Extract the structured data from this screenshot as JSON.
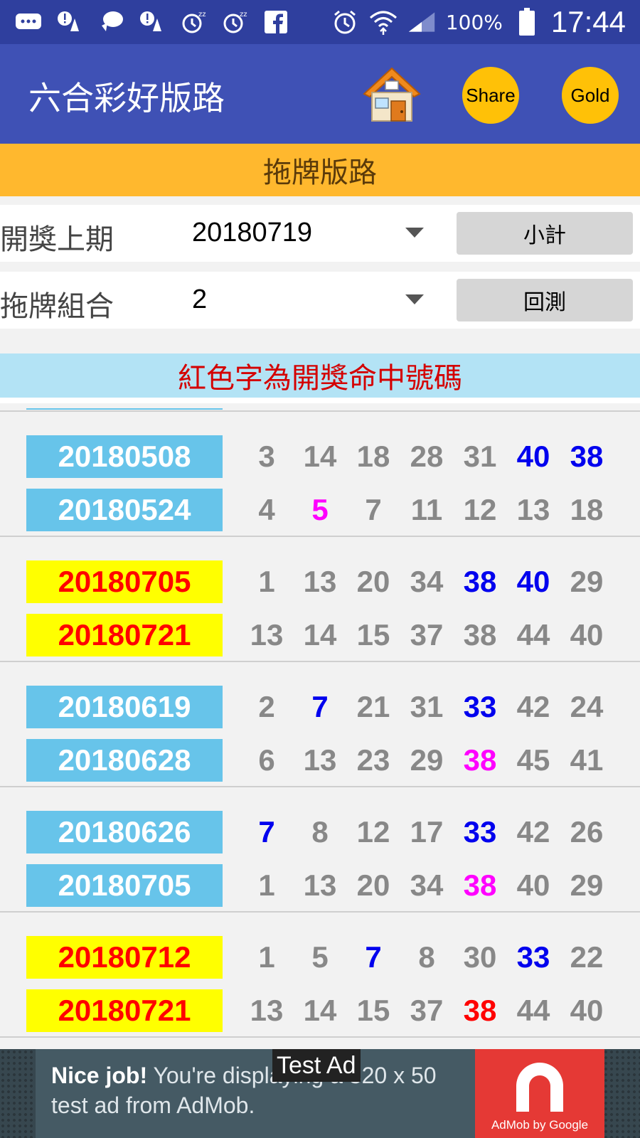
{
  "status_bar": {
    "battery": "100%",
    "time": "17:44"
  },
  "app_bar": {
    "title": "六合彩好版路",
    "share_label": "Share",
    "gold_label": "Gold"
  },
  "section": {
    "title": "拖牌版路"
  },
  "controls": {
    "period_label": "開獎上期",
    "period_value": "20180719",
    "subtotal_label": "小計",
    "combo_label": "拖牌組合",
    "combo_value": "2",
    "backtest_label": "回測"
  },
  "notice": {
    "text": "紅色字為開獎命中號碼"
  },
  "colors": {
    "gray": "#888888",
    "blue": "#0000ee",
    "magenta": "#ff00ff",
    "red": "#ff0000",
    "date_blue_bg": "#67c4ea",
    "date_yellow_bg": "#ffff00"
  },
  "groups": [
    {
      "rows": [
        {
          "date": "20180508",
          "style": "blue",
          "numbers": [
            {
              "n": "3",
              "c": "gray"
            },
            {
              "n": "14",
              "c": "gray"
            },
            {
              "n": "18",
              "c": "gray"
            },
            {
              "n": "28",
              "c": "gray"
            },
            {
              "n": "31",
              "c": "gray"
            },
            {
              "n": "40",
              "c": "blue"
            },
            {
              "n": "38",
              "c": "blue"
            }
          ]
        },
        {
          "date": "20180524",
          "style": "blue",
          "numbers": [
            {
              "n": "4",
              "c": "gray"
            },
            {
              "n": "5",
              "c": "magenta"
            },
            {
              "n": "7",
              "c": "gray"
            },
            {
              "n": "11",
              "c": "gray"
            },
            {
              "n": "12",
              "c": "gray"
            },
            {
              "n": "13",
              "c": "gray"
            },
            {
              "n": "18",
              "c": "gray"
            }
          ]
        }
      ]
    },
    {
      "rows": [
        {
          "date": "20180705",
          "style": "yellow",
          "numbers": [
            {
              "n": "1",
              "c": "gray"
            },
            {
              "n": "13",
              "c": "gray"
            },
            {
              "n": "20",
              "c": "gray"
            },
            {
              "n": "34",
              "c": "gray"
            },
            {
              "n": "38",
              "c": "blue"
            },
            {
              "n": "40",
              "c": "blue"
            },
            {
              "n": "29",
              "c": "gray"
            }
          ]
        },
        {
          "date": "20180721",
          "style": "yellow",
          "numbers": [
            {
              "n": "13",
              "c": "gray"
            },
            {
              "n": "14",
              "c": "gray"
            },
            {
              "n": "15",
              "c": "gray"
            },
            {
              "n": "37",
              "c": "gray"
            },
            {
              "n": "38",
              "c": "gray"
            },
            {
              "n": "44",
              "c": "gray"
            },
            {
              "n": "40",
              "c": "gray"
            }
          ]
        }
      ]
    },
    {
      "rows": [
        {
          "date": "20180619",
          "style": "blue",
          "numbers": [
            {
              "n": "2",
              "c": "gray"
            },
            {
              "n": "7",
              "c": "blue"
            },
            {
              "n": "21",
              "c": "gray"
            },
            {
              "n": "31",
              "c": "gray"
            },
            {
              "n": "33",
              "c": "blue"
            },
            {
              "n": "42",
              "c": "gray"
            },
            {
              "n": "24",
              "c": "gray"
            }
          ]
        },
        {
          "date": "20180628",
          "style": "blue",
          "numbers": [
            {
              "n": "6",
              "c": "gray"
            },
            {
              "n": "13",
              "c": "gray"
            },
            {
              "n": "23",
              "c": "gray"
            },
            {
              "n": "29",
              "c": "gray"
            },
            {
              "n": "38",
              "c": "magenta"
            },
            {
              "n": "45",
              "c": "gray"
            },
            {
              "n": "41",
              "c": "gray"
            }
          ]
        }
      ]
    },
    {
      "rows": [
        {
          "date": "20180626",
          "style": "blue",
          "numbers": [
            {
              "n": "7",
              "c": "blue"
            },
            {
              "n": "8",
              "c": "gray"
            },
            {
              "n": "12",
              "c": "gray"
            },
            {
              "n": "17",
              "c": "gray"
            },
            {
              "n": "33",
              "c": "blue"
            },
            {
              "n": "42",
              "c": "gray"
            },
            {
              "n": "26",
              "c": "gray"
            }
          ]
        },
        {
          "date": "20180705",
          "style": "blue",
          "numbers": [
            {
              "n": "1",
              "c": "gray"
            },
            {
              "n": "13",
              "c": "gray"
            },
            {
              "n": "20",
              "c": "gray"
            },
            {
              "n": "34",
              "c": "gray"
            },
            {
              "n": "38",
              "c": "magenta"
            },
            {
              "n": "40",
              "c": "gray"
            },
            {
              "n": "29",
              "c": "gray"
            }
          ]
        }
      ]
    },
    {
      "rows": [
        {
          "date": "20180712",
          "style": "yellow",
          "numbers": [
            {
              "n": "1",
              "c": "gray"
            },
            {
              "n": "5",
              "c": "gray"
            },
            {
              "n": "7",
              "c": "blue"
            },
            {
              "n": "8",
              "c": "gray"
            },
            {
              "n": "30",
              "c": "gray"
            },
            {
              "n": "33",
              "c": "blue"
            },
            {
              "n": "22",
              "c": "gray"
            }
          ]
        },
        {
          "date": "20180721",
          "style": "yellow",
          "numbers": [
            {
              "n": "13",
              "c": "gray"
            },
            {
              "n": "14",
              "c": "gray"
            },
            {
              "n": "15",
              "c": "gray"
            },
            {
              "n": "37",
              "c": "gray"
            },
            {
              "n": "38",
              "c": "red"
            },
            {
              "n": "44",
              "c": "gray"
            },
            {
              "n": "40",
              "c": "gray"
            }
          ]
        }
      ]
    }
  ],
  "ad": {
    "label": "Test Ad",
    "headline": "Nice job!",
    "body": " You're displaying a 320 x 50 test ad from AdMob.",
    "brand": "AdMob by Google"
  }
}
